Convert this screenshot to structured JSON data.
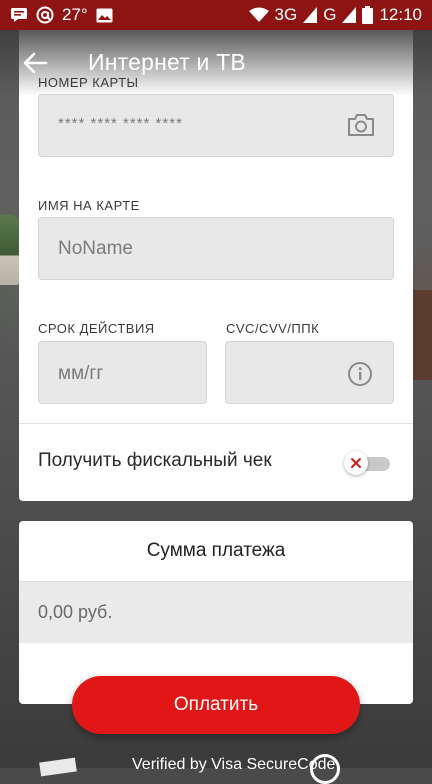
{
  "status_bar": {
    "temperature": "27°",
    "network_3g": "3G",
    "network_g": "G",
    "time": "12:10"
  },
  "header": {
    "title": "Интернет и ТВ"
  },
  "form": {
    "card_number": {
      "label": "НОМЕР КАРТЫ",
      "placeholder": "**** **** **** ****"
    },
    "card_name": {
      "label": "ИМЯ НА КАРТЕ",
      "placeholder": "NoName"
    },
    "expiry": {
      "label": "СРОК ДЕЙСТВИЯ",
      "placeholder": "мм/гг"
    },
    "cvc": {
      "label": "CVC/CVV/ППК",
      "placeholder": ""
    },
    "fiscal_receipt": {
      "label": "Получить фискальный чек",
      "enabled": false
    }
  },
  "payment": {
    "sum_title": "Сумма платежа",
    "sum_value": "0,00 руб."
  },
  "pay_button": {
    "label": "Оплатить"
  },
  "bottom": {
    "peek_text": "Verified by Visa   SecureCode"
  },
  "colors": {
    "accent": "#e11616",
    "status_bar": "#8e1414",
    "field_bg": "#e8e8e8"
  }
}
